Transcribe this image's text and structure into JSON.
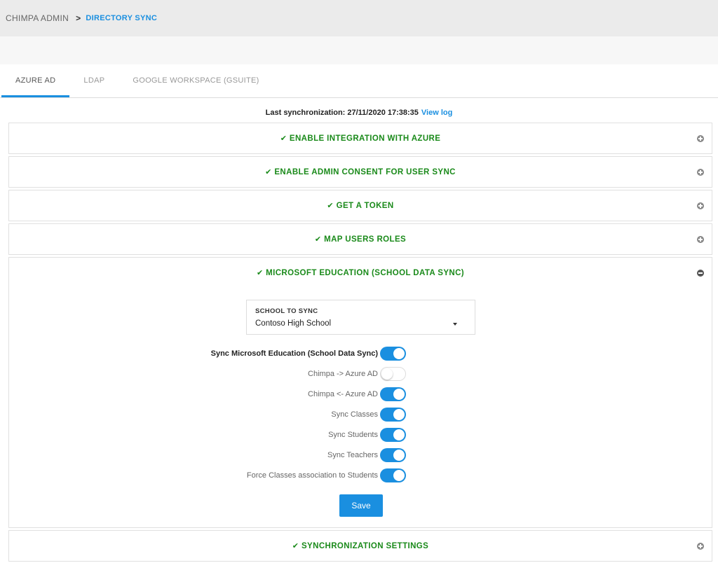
{
  "breadcrumb": {
    "root": "CHIMPA ADMIN",
    "separator": ">",
    "current": "DIRECTORY SYNC"
  },
  "tabs": [
    {
      "label": "AZURE AD",
      "active": true
    },
    {
      "label": "LDAP",
      "active": false
    },
    {
      "label": "GOOGLE WORKSPACE (GSUITE)",
      "active": false
    }
  ],
  "last_sync": {
    "label": "Last synchronization: 27/11/2020 17:38:35",
    "link": "View log"
  },
  "panels": [
    {
      "title": "ENABLE INTEGRATION WITH AZURE",
      "icon": "plus-circle-icon",
      "expanded": false
    },
    {
      "title": "ENABLE ADMIN CONSENT FOR USER SYNC",
      "icon": "plus-circle-icon",
      "expanded": false
    },
    {
      "title": "GET A TOKEN",
      "icon": "plus-circle-icon",
      "expanded": false
    },
    {
      "title": "MAP USERS ROLES",
      "icon": "plus-circle-icon",
      "expanded": false
    },
    {
      "title": "MICROSOFT EDUCATION (SCHOOL DATA SYNC)",
      "icon": "minus-circle-icon",
      "expanded": true
    },
    {
      "title": "SYNCHRONIZATION SETTINGS",
      "icon": "plus-circle-icon",
      "expanded": false
    }
  ],
  "check_icon": "✔",
  "school_select": {
    "label": "SCHOOL TO SYNC",
    "value": "Contoso High School"
  },
  "options": [
    {
      "label": "Sync Microsoft Education (School Data Sync)",
      "on": true,
      "bold": true
    },
    {
      "label": "Chimpa -> Azure AD",
      "on": false
    },
    {
      "label": "Chimpa <- Azure AD",
      "on": true
    },
    {
      "label": "Sync Classes",
      "on": true
    },
    {
      "label": "Sync Students",
      "on": true
    },
    {
      "label": "Sync Teachers",
      "on": true
    },
    {
      "label": "Force Classes association to Students",
      "on": true
    }
  ],
  "save_label": "Save",
  "colors": {
    "accent": "#1a8fe0",
    "success": "#1a8a1a"
  }
}
